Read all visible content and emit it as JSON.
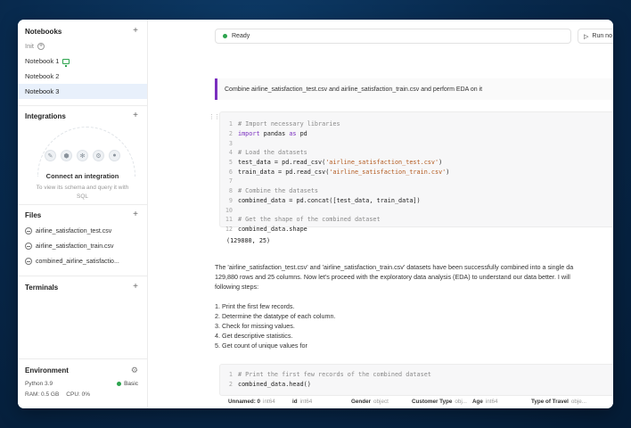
{
  "sidebar": {
    "notebooks": {
      "title": "Notebooks",
      "init_label": "Init",
      "items": [
        "Notebook 1",
        "Notebook 2",
        "Notebook 3"
      ]
    },
    "integrations": {
      "title": "Integrations",
      "connect_title": "Connect an integration",
      "connect_sub": "To view its schema and query it with SQL"
    },
    "files": {
      "title": "Files",
      "items": [
        "airline_satisfaction_test.csv",
        "airline_satisfaction_train.csv",
        "combined_airline_satisfactio..."
      ]
    },
    "terminals": {
      "title": "Terminals"
    },
    "environment": {
      "title": "Environment",
      "python": "Python 3.9",
      "tier": "Basic",
      "ram": "RAM: 0.5 GB",
      "cpu": "CPU: 0%"
    }
  },
  "topbar": {
    "status": "Ready",
    "run_label": "Run no"
  },
  "prompt": "Combine airline_satisfaction_test.csv and airline_satisfaction_train.csv and perform EDA on it",
  "cell1": {
    "lines": [
      {
        "n": "1",
        "text": "# Import necessary libraries"
      },
      {
        "n": "2",
        "text": "import pandas as pd"
      },
      {
        "n": "3",
        "text": ""
      },
      {
        "n": "4",
        "text": "# Load the datasets"
      },
      {
        "n": "5",
        "text": "test_data = pd.read_csv('airline_satisfaction_test.csv')"
      },
      {
        "n": "6",
        "text": "train_data = pd.read_csv('airline_satisfaction_train.csv')"
      },
      {
        "n": "7",
        "text": ""
      },
      {
        "n": "8",
        "text": "# Combine the datasets"
      },
      {
        "n": "9",
        "text": "combined_data = pd.concat([test_data, train_data])"
      },
      {
        "n": "10",
        "text": ""
      },
      {
        "n": "11",
        "text": "# Get the shape of the combined dataset"
      },
      {
        "n": "12",
        "text": "combined_data.shape"
      }
    ],
    "output": "(129880, 25)"
  },
  "paragraph": [
    "The 'airline_satisfaction_test.csv' and 'airline_satisfaction_train.csv' datasets have been successfully combined into a single da",
    "129,880 rows and 25 columns. Now let's proceed with the exploratory data analysis (EDA) to understand our data better. I will",
    "following steps:",
    "",
    "1. Print the first few records.",
    "2. Determine the datatype of each column.",
    "3. Check for missing values.",
    "4. Get descriptive statistics.",
    "5. Get count of unique values for"
  ],
  "cell2": {
    "lines": [
      {
        "n": "1",
        "text": "# Print the first few records of the combined dataset"
      },
      {
        "n": "2",
        "text": "combined_data.head()"
      }
    ]
  },
  "table_headers": [
    {
      "name": "Unnamed: 0",
      "type": "int64"
    },
    {
      "name": "id",
      "type": "int64"
    },
    {
      "name": "Gender",
      "type": "object"
    },
    {
      "name": "Customer Type",
      "type": "obj..."
    },
    {
      "name": "Age",
      "type": "int64"
    },
    {
      "name": "Type of Travel",
      "type": "obje..."
    }
  ],
  "colors": {
    "accent_purple": "#7a2fbf",
    "status_green": "#2da44e",
    "active_bg": "#e8f0fb"
  }
}
